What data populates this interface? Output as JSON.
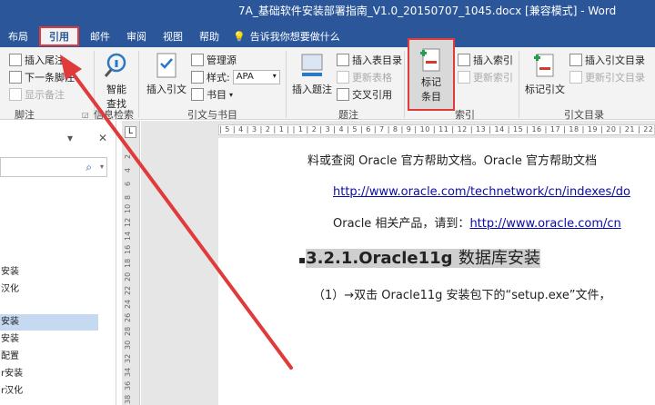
{
  "window": {
    "title": "7A_基础软件安装部署指南_V1.0_20150707_1045.docx [兼容模式] - Word"
  },
  "tabs": [
    {
      "label": "布局"
    },
    {
      "label": "引用"
    },
    {
      "label": "邮件"
    },
    {
      "label": "审阅"
    },
    {
      "label": "视图"
    },
    {
      "label": "帮助"
    }
  ],
  "tell_me": "告诉我你想要做什么",
  "ribbon": {
    "footnotes": {
      "insert_endnote": "插入尾注",
      "next_footnote": "下一条脚注",
      "show_notes": "显示备注",
      "group_label": "脚注"
    },
    "research": {
      "smart_lookup_line1": "智能",
      "smart_lookup_line2": "查找",
      "group_label": "信息检索"
    },
    "citations": {
      "insert_citation": "插入引文",
      "manage_sources": "管理源",
      "style_label": "样式:",
      "style_value": "APA",
      "bibliography": "书目",
      "group_label": "引文与书目"
    },
    "captions": {
      "insert_caption": "插入题注",
      "insert_table_of_figures": "插入表目录",
      "update_table": "更新表格",
      "cross_reference": "交叉引用",
      "group_label": "题注"
    },
    "index": {
      "mark_entry_line1": "标记",
      "mark_entry_line2": "条目",
      "insert_index": "插入索引",
      "update_index": "更新索引",
      "group_label": "索引"
    },
    "toa": {
      "mark_citation": "标记引文",
      "insert_toa": "插入引文目录",
      "update_table": "更新引文目录",
      "group_label": "引文目录"
    }
  },
  "nav_pane": {
    "search_icon": "search-icon",
    "items": [
      {
        "label": "安装",
        "selected": false
      },
      {
        "label": "汉化",
        "selected": false
      },
      {
        "label": "安装",
        "selected": true
      },
      {
        "label": "安装",
        "selected": false
      },
      {
        "label": "配置",
        "selected": false
      },
      {
        "label": "r安装",
        "selected": false
      },
      {
        "label": "r汉化",
        "selected": false
      }
    ]
  },
  "ruler": {
    "horizontal_ticks": "| 5 | 4 | 3 | 2 | 1 |   | 1 | 2 | 3 | 4 | 5 | 6 | 7 | 8 | 9 | 10 | 11 | 12 | 13 | 14 | 15 | 16 | 17 | 18 | 19 | 20 | 21 | 22 | 23 | 24 | 25 |",
    "corner": "L",
    "vertical_numbers": [
      "2",
      "4",
      "6",
      "8",
      "10",
      "12",
      "14",
      "16",
      "18",
      "20",
      "22",
      "24",
      "26",
      "28",
      "30",
      "32",
      "34",
      "36",
      "38",
      "40"
    ]
  },
  "document": {
    "line1": "料或查阅 Oracle 官方帮助文档。Oracle 官方帮助文档",
    "link1": "http://www.oracle.com/technetwork/cn/indexes/do",
    "line3_prefix": "Oracle 相关产品，请到：",
    "link2": "http://www.oracle.com/cn",
    "heading_number": "3.2.1.Oracle11g",
    "heading_text": "数据库安装",
    "step1": "（1）→双击 Oracle11g 安装包下的“setup.exe”文件，"
  },
  "colors": {
    "title_bar": "#2b579a",
    "highlight_box": "#e03a3a",
    "link": "#0a0aa6"
  }
}
